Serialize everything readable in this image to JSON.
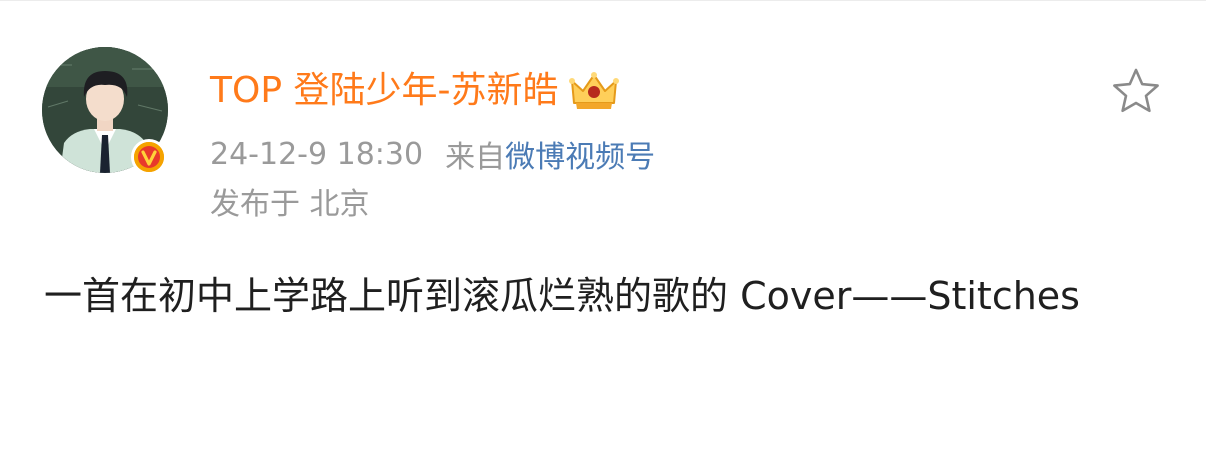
{
  "post": {
    "author_name": "TOP 登陆少年-苏新皓",
    "timestamp": "24-12-9 18:30",
    "source_prefix": "来自",
    "source_name": "微博视频号",
    "location": "发布于 北京",
    "content_text": "一首在初中上学路上听到滚瓜烂熟的歌的 Cover——Stitches"
  },
  "icons": {
    "avatar": "avatar-image",
    "verified_badge": "verified-v-icon",
    "vip_badge": "crown-icon",
    "favorite": "star-outline-icon"
  },
  "colors": {
    "username": "#ff7a1a",
    "meta": "#9a9a9a",
    "source_link": "#4b7bb5",
    "content": "#1f1f1f",
    "verified_badge": "#f5a300"
  }
}
